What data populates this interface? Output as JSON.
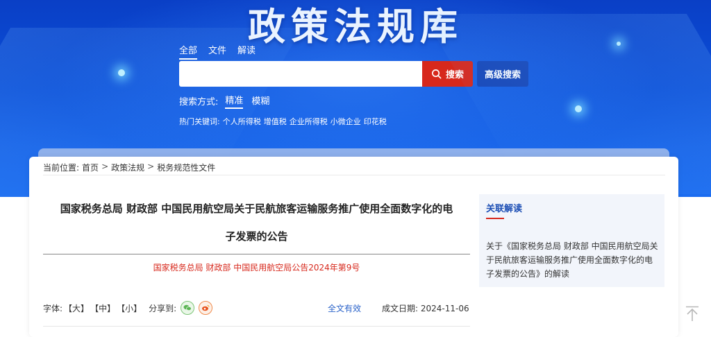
{
  "banner": {
    "title": "政策法规库",
    "scope_tabs": [
      {
        "label": "全部",
        "active": true
      },
      {
        "label": "文件",
        "active": false
      },
      {
        "label": "解读",
        "active": false
      }
    ],
    "search": {
      "value": "",
      "placeholder": "",
      "button_label": "搜索",
      "advanced_label": "高级搜索"
    },
    "search_mode": {
      "label": "搜索方式:",
      "options": [
        {
          "label": "精准",
          "active": true
        },
        {
          "label": "模糊",
          "active": false
        }
      ]
    },
    "hot_keywords": {
      "label": "热门关键词:",
      "items": [
        "个人所得税",
        "增值税",
        "企业所得税",
        "小微企业",
        "印花税"
      ]
    }
  },
  "breadcrumb": {
    "label": "当前位置:",
    "items": [
      "首页",
      "政策法规",
      "税务规范性文件"
    ],
    "separator": ">"
  },
  "document": {
    "title_line1": "国家税务总局 财政部 中国民用航空局关于民航旅客运输服务推广使用全面数字化的电",
    "title_line2": "子发票的公告",
    "number": "国家税务总局 财政部 中国民用航空局公告2024年第9号",
    "font_label": "字体:",
    "font_large": "【大】",
    "font_medium": "【中】",
    "font_small": "【小】",
    "share_label": "分享到:",
    "validity": "全文有效",
    "date_label": "成文日期:",
    "date_value": "2024-11-06"
  },
  "related": {
    "heading": "关联解读",
    "link": "关于《国家税务总局 财政部 中国民用航空局关于民航旅客运输服务推广使用全面数字化的电子发票的公告》的解读"
  },
  "colors": {
    "banner_blue": "#0b4fd8",
    "search_red": "#d7281c",
    "advanced_blue": "#1747b8",
    "link_blue": "#2a62c9"
  },
  "icons": [
    "search-icon",
    "wechat-icon",
    "weibo-icon",
    "back-to-top-icon"
  ]
}
